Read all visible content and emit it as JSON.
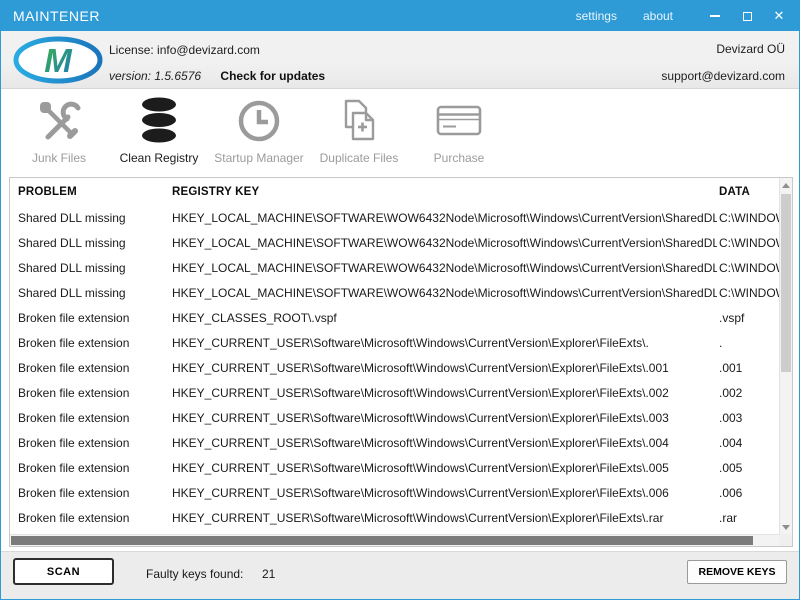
{
  "colors": {
    "titlebar_blue": "#2e9bd6",
    "inactive_gray": "#9b9b9b"
  },
  "titlebar": {
    "title": "MAINTENER",
    "settings_label": "settings",
    "about_label": "about",
    "close_glyph": "✕"
  },
  "header": {
    "license_line": "License: info@devizard.com",
    "version_label": "version: 1.5.6576",
    "check_updates_label": "Check for updates",
    "company": "Devizard OÜ",
    "support_email": "support@devizard.com"
  },
  "toolbar": {
    "items": [
      {
        "label": "Junk Files",
        "icon": "junk-files-icon",
        "active": false
      },
      {
        "label": "Clean Registry",
        "icon": "clean-registry-icon",
        "active": true
      },
      {
        "label": "Startup Manager",
        "icon": "startup-manager-icon",
        "active": false
      },
      {
        "label": "Duplicate Files",
        "icon": "duplicate-files-icon",
        "active": false
      },
      {
        "label": "Purchase",
        "icon": "purchase-icon",
        "active": false
      }
    ]
  },
  "table": {
    "columns": [
      "PROBLEM",
      "REGISTRY KEY",
      "DATA"
    ],
    "rows": [
      {
        "problem": "Shared DLL missing",
        "key": "HKEY_LOCAL_MACHINE\\SOFTWARE\\WOW6432Node\\Microsoft\\Windows\\CurrentVersion\\SharedDLLs",
        "data": "C:\\WINDOWS"
      },
      {
        "problem": "Shared DLL missing",
        "key": "HKEY_LOCAL_MACHINE\\SOFTWARE\\WOW6432Node\\Microsoft\\Windows\\CurrentVersion\\SharedDLLs",
        "data": "C:\\WINDOWS"
      },
      {
        "problem": "Shared DLL missing",
        "key": "HKEY_LOCAL_MACHINE\\SOFTWARE\\WOW6432Node\\Microsoft\\Windows\\CurrentVersion\\SharedDLLs",
        "data": "C:\\WINDOWS"
      },
      {
        "problem": "Shared DLL missing",
        "key": "HKEY_LOCAL_MACHINE\\SOFTWARE\\WOW6432Node\\Microsoft\\Windows\\CurrentVersion\\SharedDLLs",
        "data": "C:\\WINDOWS"
      },
      {
        "problem": "Broken file extension",
        "key": "HKEY_CLASSES_ROOT\\.vspf",
        "data": ".vspf"
      },
      {
        "problem": "Broken file extension",
        "key": "HKEY_CURRENT_USER\\Software\\Microsoft\\Windows\\CurrentVersion\\Explorer\\FileExts\\.",
        "data": "."
      },
      {
        "problem": "Broken file extension",
        "key": "HKEY_CURRENT_USER\\Software\\Microsoft\\Windows\\CurrentVersion\\Explorer\\FileExts\\.001",
        "data": ".001"
      },
      {
        "problem": "Broken file extension",
        "key": "HKEY_CURRENT_USER\\Software\\Microsoft\\Windows\\CurrentVersion\\Explorer\\FileExts\\.002",
        "data": ".002"
      },
      {
        "problem": "Broken file extension",
        "key": "HKEY_CURRENT_USER\\Software\\Microsoft\\Windows\\CurrentVersion\\Explorer\\FileExts\\.003",
        "data": ".003"
      },
      {
        "problem": "Broken file extension",
        "key": "HKEY_CURRENT_USER\\Software\\Microsoft\\Windows\\CurrentVersion\\Explorer\\FileExts\\.004",
        "data": ".004"
      },
      {
        "problem": "Broken file extension",
        "key": "HKEY_CURRENT_USER\\Software\\Microsoft\\Windows\\CurrentVersion\\Explorer\\FileExts\\.005",
        "data": ".005"
      },
      {
        "problem": "Broken file extension",
        "key": "HKEY_CURRENT_USER\\Software\\Microsoft\\Windows\\CurrentVersion\\Explorer\\FileExts\\.006",
        "data": ".006"
      },
      {
        "problem": "Broken file extension",
        "key": "HKEY_CURRENT_USER\\Software\\Microsoft\\Windows\\CurrentVersion\\Explorer\\FileExts\\.rar",
        "data": ".rar"
      }
    ]
  },
  "footer": {
    "scan_label": "SCAN",
    "faulty_label": "Faulty keys found:",
    "faulty_count": "21",
    "remove_label": "REMOVE KEYS"
  }
}
